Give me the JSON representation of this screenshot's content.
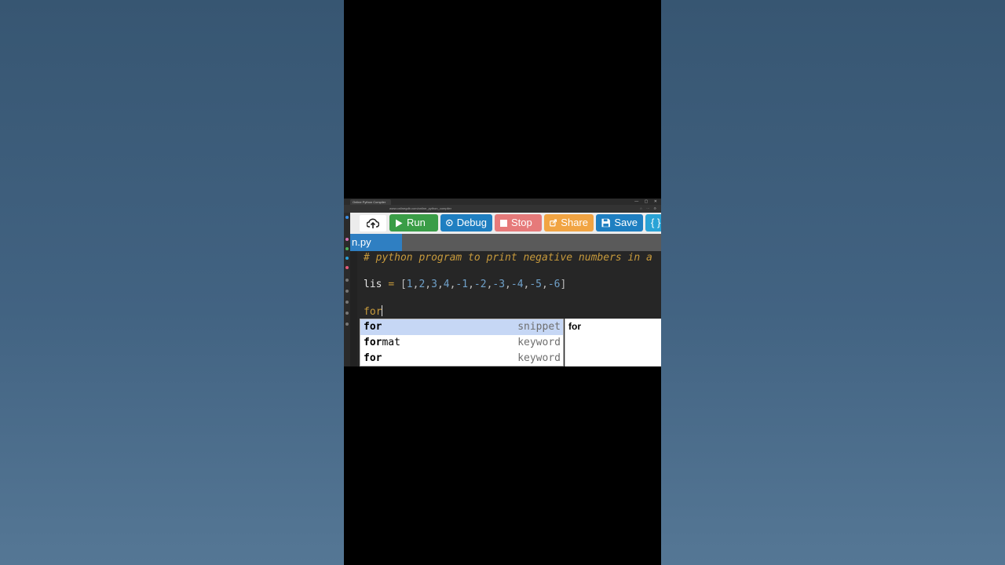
{
  "browser": {
    "tab_title": "Online Python Compiler",
    "window_controls": "— ▢ ✕",
    "url": "www.onlinegdb.com/online_python_compiler",
    "address_icons": "☆ ⋯ ⚙"
  },
  "toolbar": {
    "upload_icon": "cloud-upload-icon",
    "run_label": "Run",
    "debug_label": "Debug",
    "stop_label": "Stop",
    "share_label": "Share",
    "save_label": "Save",
    "beautify_label": "{ } B",
    "colors": {
      "run": "#3a9d47",
      "debug": "#1f7fc1",
      "stop": "#e67a7a",
      "share": "#f1a443",
      "save": "#1f7fc1",
      "beautify": "#2aa3d6"
    }
  },
  "file": {
    "tab_label": "n.py"
  },
  "editor": {
    "comment": "# python program to print negative numbers in a",
    "line2_ident": "lis",
    "line2_op": "=",
    "list_values": [
      "1",
      "2",
      "3",
      "4",
      "-1",
      "-2",
      "-3",
      "-4",
      "-5",
      "-6"
    ],
    "line3_text": "for"
  },
  "autocomplete": {
    "items": [
      {
        "match": "for",
        "rest": "",
        "type": "snippet"
      },
      {
        "match": "for",
        "rest": "mat",
        "type": "keyword"
      },
      {
        "match": "for",
        "rest": "",
        "type": "keyword"
      }
    ],
    "doc_title": "for"
  }
}
